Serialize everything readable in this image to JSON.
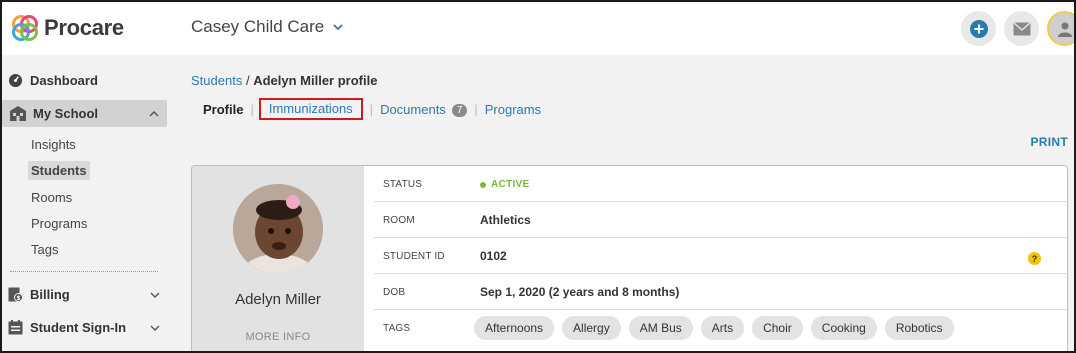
{
  "app": {
    "name": "Procare"
  },
  "header": {
    "school_name": "Casey Child Care"
  },
  "sidebar": {
    "dashboard": "Dashboard",
    "my_school": "My School",
    "sub_items": [
      "Insights",
      "Students",
      "Rooms",
      "Programs",
      "Tags"
    ],
    "active_sub": "Students",
    "billing": "Billing",
    "sign_in": "Student Sign-In"
  },
  "breadcrumb": {
    "parent": "Students",
    "separator": "/",
    "current": "Adelyn Miller profile"
  },
  "tabs": [
    {
      "label": "Profile",
      "active": true
    },
    {
      "label": "Immunizations",
      "highlighted": true
    },
    {
      "label": "Documents",
      "count": "7"
    },
    {
      "label": "Programs"
    }
  ],
  "print_label": "PRINT",
  "student": {
    "name": "Adelyn Miller",
    "more_info": "MORE INFO",
    "fields": {
      "status_label": "STATUS",
      "status_value": "ACTIVE",
      "room_label": "ROOM",
      "room_value": "Athletics",
      "id_label": "STUDENT ID",
      "id_value": "0102",
      "dob_label": "DOB",
      "dob_value": "Sep 1, 2020 (2 years and 8 months)",
      "tags_label": "TAGS"
    },
    "tags": [
      "Afternoons",
      "Allergy",
      "AM Bus",
      "Arts",
      "Choir",
      "Cooking",
      "Robotics"
    ]
  },
  "colors": {
    "accent": "#2a7ab0",
    "active": "#79b93a",
    "highlight": "#d4171a",
    "help": "#f2c00d"
  }
}
